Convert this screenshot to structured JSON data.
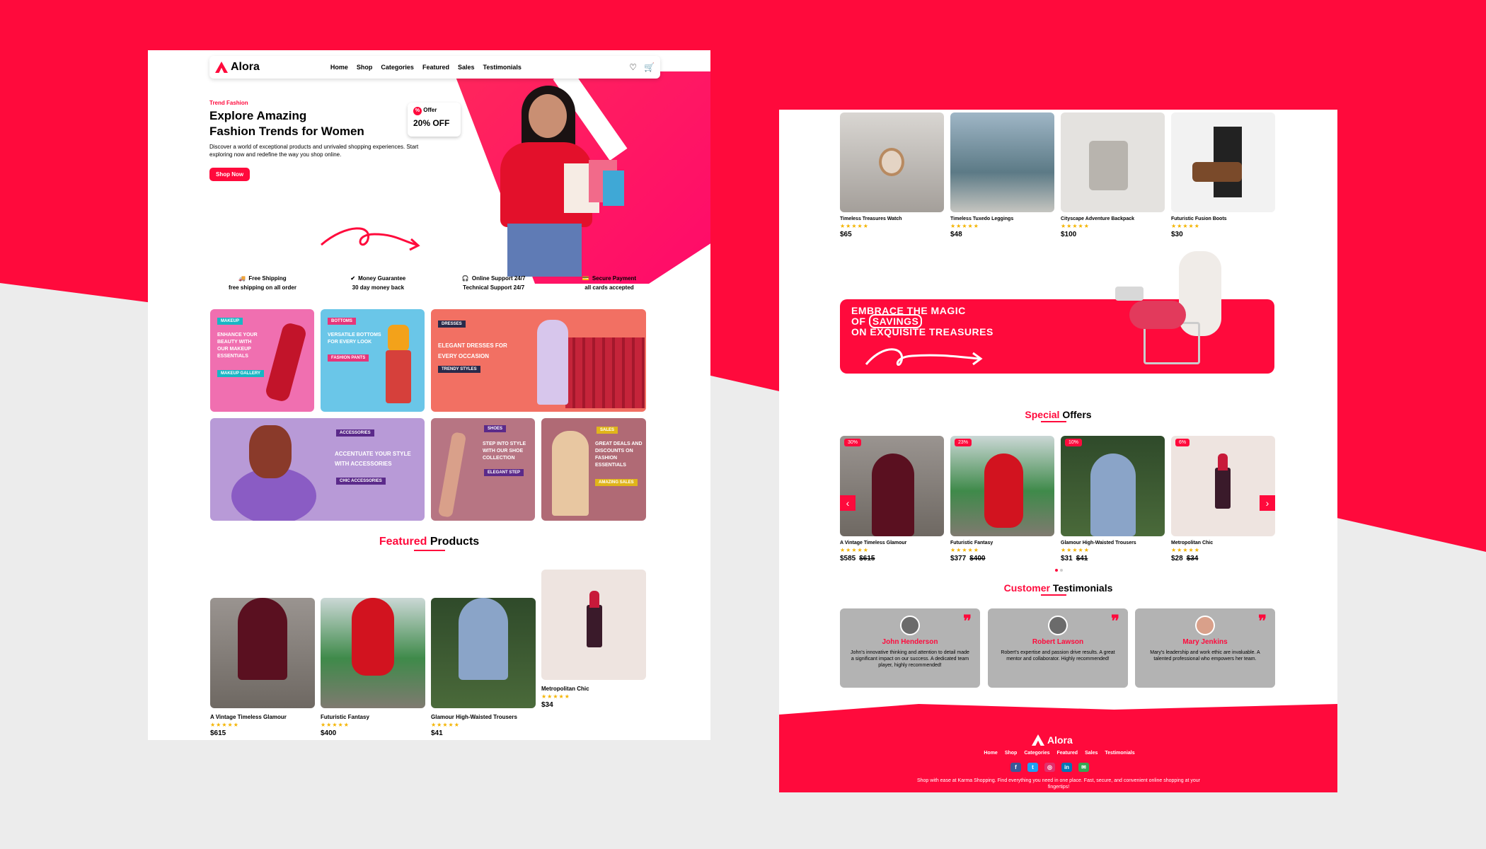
{
  "brand": "Alora",
  "colors": {
    "accent": "#ff0a3c"
  },
  "nav": {
    "items": [
      "Home",
      "Shop",
      "Categories",
      "Featured",
      "Sales",
      "Testimonials"
    ],
    "icons": [
      "heart-icon",
      "cart-icon"
    ]
  },
  "hero": {
    "tag": "Trend Fashion",
    "title_line1": "Explore Amazing",
    "title_line2": "Fashion Trends for Women",
    "desc": "Discover a world of exceptional products and unrivaled shopping experiences. Start exploring now and redefine the way you shop online.",
    "cta": "Shop Now",
    "offer_label": "Offer",
    "offer_value": "20% OFF"
  },
  "features": [
    {
      "title": "Free Shipping",
      "sub": "free shipping on all order"
    },
    {
      "title": "Money Guarantee",
      "sub": "30 day money back"
    },
    {
      "title": "Online Support 24/7",
      "sub": "Technical Support 24/7"
    },
    {
      "title": "Secure Payment",
      "sub": "all cards accepted"
    }
  ],
  "categories": {
    "makeup": {
      "tag": "MAKEUP",
      "text": "ENHANCE YOUR BEAUTY WITH OUR MAKEUP ESSENTIALS",
      "cta": "MAKEUP GALLERY"
    },
    "bottoms": {
      "tag": "BOTTOMS",
      "text": "VERSATILE BOTTOMS FOR EVERY LOOK",
      "cta": "FASHION PANTS"
    },
    "dresses": {
      "tag": "DRESSES",
      "text": "ELEGANT DRESSES FOR EVERY OCCASION",
      "cta": "TRENDY STYLES"
    },
    "accessories": {
      "tag": "ACCESSORIES",
      "text": "ACCENTUATE YOUR STYLE WITH ACCESSORIES",
      "cta": "CHIC ACCESSORIES"
    },
    "shoes": {
      "tag": "SHOES",
      "text": "STEP INTO STYLE WITH OUR SHOE COLLECTION",
      "cta": "ELEGANT STEP"
    },
    "sales": {
      "tag": "SALES",
      "text": "GREAT DEALS AND DISCOUNTS ON FASHION ESSENTIALS",
      "cta": "AMAZING SALES"
    }
  },
  "featured": {
    "title_a": "Featured",
    "title_b": " Products",
    "products": [
      {
        "name": "A Vintage Timeless Glamour",
        "stars": "★★★★★",
        "price": "$615"
      },
      {
        "name": "Futuristic Fantasy",
        "stars": "★★★★★",
        "price": "$400"
      },
      {
        "name": "Glamour High-Waisted Trousers",
        "stars": "★★★★★",
        "price": "$41"
      },
      {
        "name": "Metropolitan Chic",
        "stars": "★★★★★",
        "price": "$34"
      }
    ]
  },
  "top_products": [
    {
      "name": "Timeless Treasures Watch",
      "stars": "★★★★★",
      "price": "$65"
    },
    {
      "name": "Timeless Tuxedo Leggings",
      "stars": "★★★★★",
      "price": "$48"
    },
    {
      "name": "Cityscape Adventure Backpack",
      "stars": "★★★★★",
      "price": "$100"
    },
    {
      "name": "Futuristic Fusion Boots",
      "stars": "★★★★★",
      "price": "$30"
    }
  ],
  "banner": {
    "line1": "EMBRACE THE MAGIC",
    "line2a": "OF ",
    "line2b": "SAVINGS",
    "line3": "ON EXQUISITE TREASURES"
  },
  "special": {
    "title_a": "Special",
    "title_b": " Offers",
    "items": [
      {
        "discount": "30%",
        "name": "A Vintage Timeless Glamour",
        "stars": "★★★★★",
        "price": "$585",
        "old": "$615"
      },
      {
        "discount": "23%",
        "name": "Futuristic Fantasy",
        "stars": "★★★★★",
        "price": "$377",
        "old": "$400"
      },
      {
        "discount": "10%",
        "name": "Glamour High-Waisted Trousers",
        "stars": "★★★★★",
        "price": "$31",
        "old": "$41"
      },
      {
        "discount": "6%",
        "name": "Metropolitan Chic",
        "stars": "★★★★★",
        "price": "$28",
        "old": "$34"
      }
    ]
  },
  "testimonials": {
    "title_a": "Customer",
    "title_b": " Testimonials",
    "items": [
      {
        "name": "John Henderson",
        "text": "John's innovative thinking and attention to detail made a significant impact on our success. A dedicated team player, highly recommended!"
      },
      {
        "name": "Robert Lawson",
        "text": "Robert's expertise and passion drive results. A great mentor and collaborator. Highly recommended!"
      },
      {
        "name": "Mary Jenkins",
        "text": "Mary's leadership and work ethic are invaluable. A talented professional who empowers her team."
      }
    ]
  },
  "footer": {
    "brand": "Alora",
    "links": [
      "Home",
      "Shop",
      "Categories",
      "Featured",
      "Sales",
      "Testimonials"
    ],
    "social": [
      "facebook-icon",
      "twitter-icon",
      "instagram-icon",
      "linkedin-icon",
      "mail-icon"
    ],
    "note": "Shop with ease at Karma Shopping. Find everything you need in one place. Fast, secure, and convenient online shopping at your fingertips!"
  }
}
